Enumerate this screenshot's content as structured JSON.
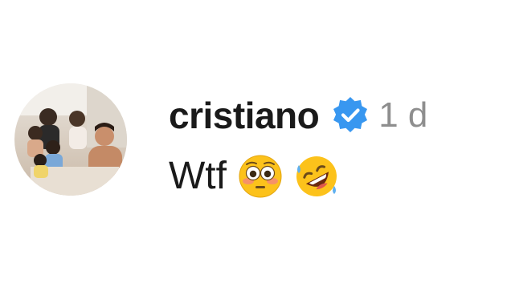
{
  "comment": {
    "avatar_icon": "profile-photo-avatar",
    "username": "cristiano",
    "verified_icon": "verified-badge-icon",
    "verified_color": "#3897f0",
    "time_ago": "1 d",
    "text": "Wtf",
    "emojis": [
      "flushed-face-emoji",
      "rolling-on-floor-laughing-emoji"
    ]
  }
}
